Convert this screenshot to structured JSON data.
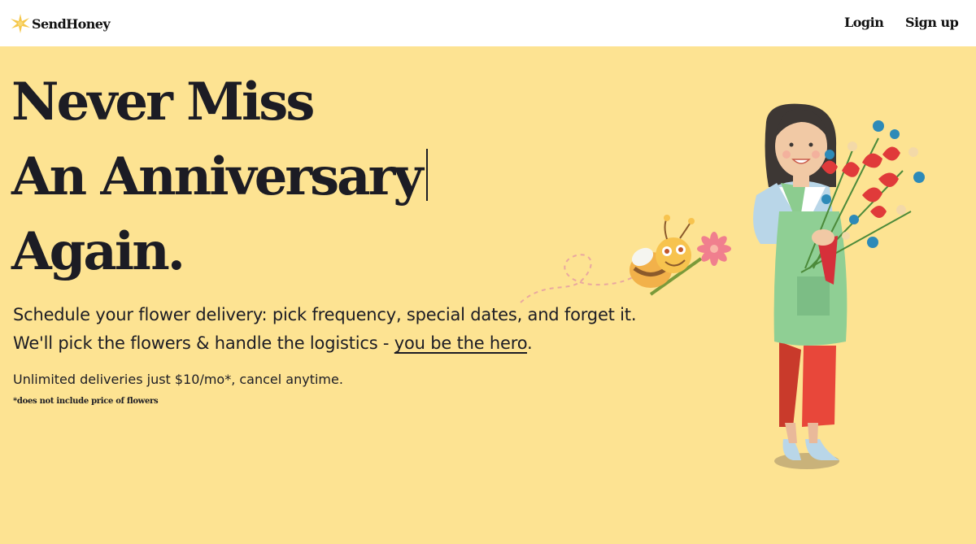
{
  "header": {
    "brand": "SendHoney",
    "logo_icon": "honey-sparkle-icon",
    "nav": {
      "login": "Login",
      "signup": "Sign up"
    }
  },
  "hero": {
    "headline_lines": [
      "Never Miss",
      "An Anniversary",
      "Again."
    ],
    "lede_line1": "Schedule your flower delivery: pick frequency, special dates, and forget it.",
    "lede_line2_prefix": "We'll pick the flowers & handle the logistics - ",
    "lede_link": "you be the hero",
    "lede_line2_suffix": ".",
    "pricing": "Unlimited deliveries just $10/mo*, cancel anytime.",
    "footnote": "*does not include price of flowers"
  },
  "illustrations": {
    "bee": "bee-with-flower-icon",
    "florist": "woman-holding-bouquet-illustration"
  },
  "colors": {
    "background": "#fde392",
    "header_bg": "#ffffff",
    "text": "#1c1c24",
    "brand_accent": "#f5c74a"
  }
}
